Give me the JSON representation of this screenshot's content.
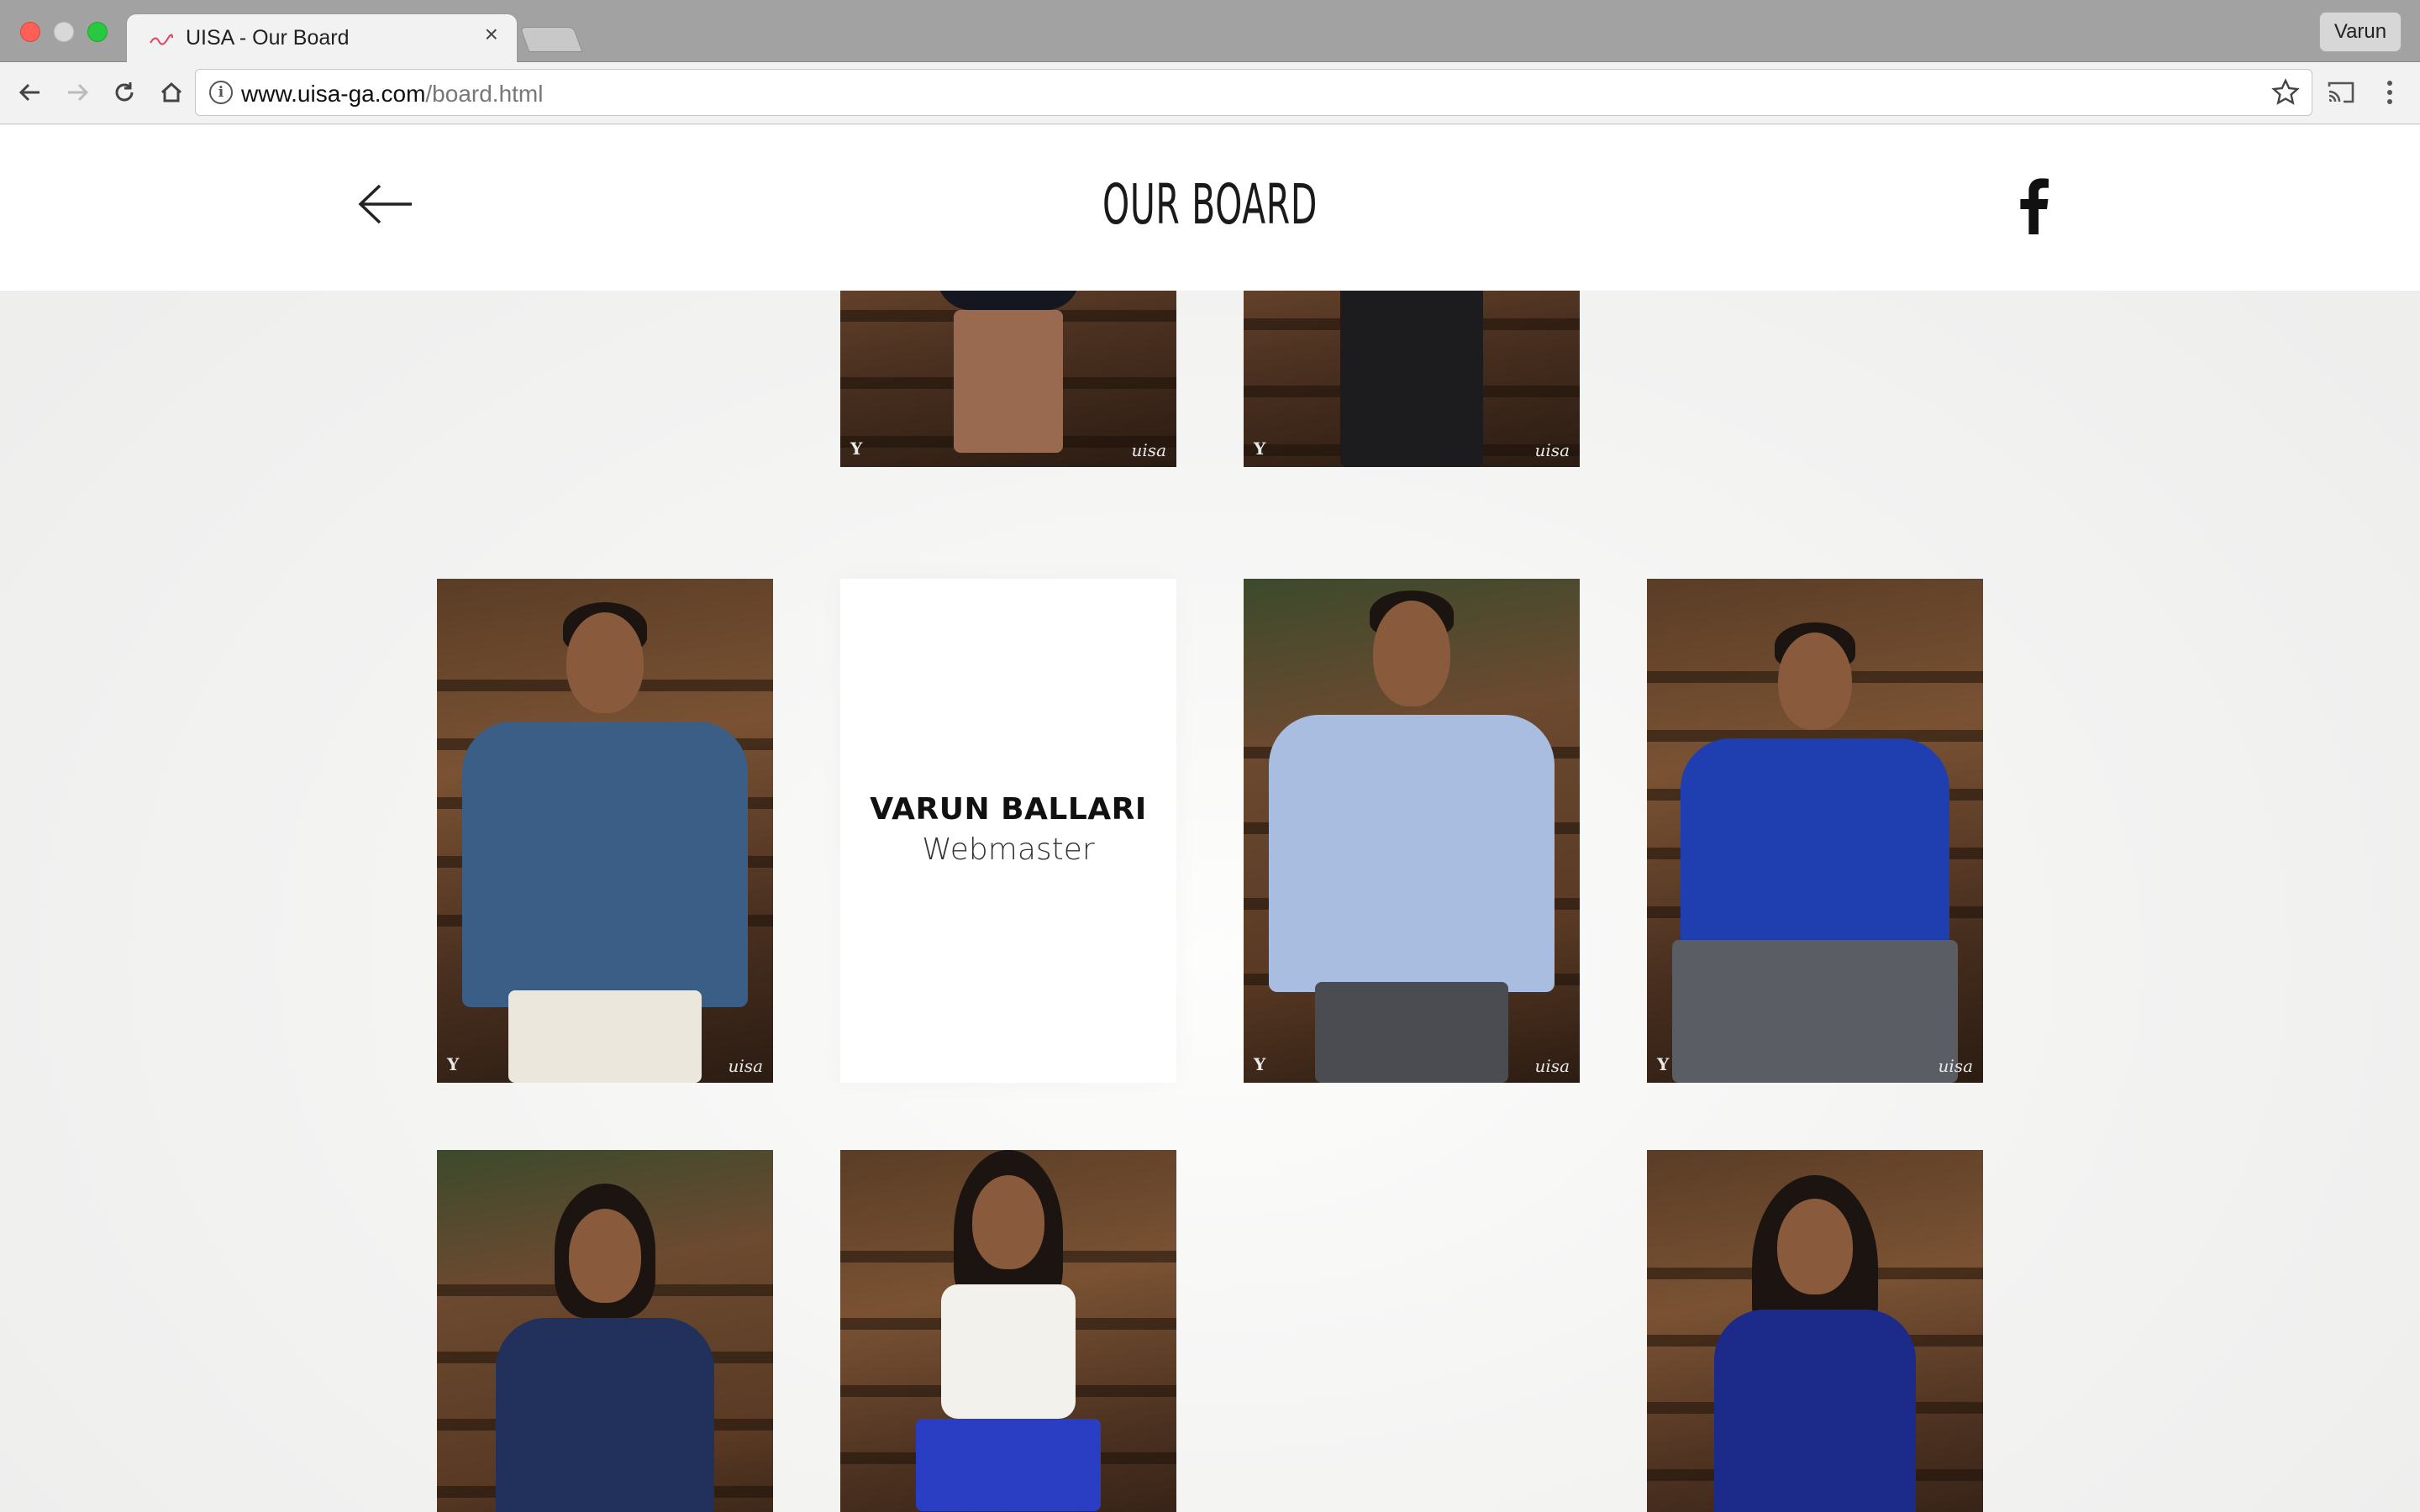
{
  "browser": {
    "tab_title": "UISA - Our Board",
    "tab_close": "×",
    "profile_name": "Varun",
    "url_host": "www.uisa-ga.com",
    "url_path": "/board.html"
  },
  "header": {
    "title": "OUR BOARD"
  },
  "board": {
    "featured": {
      "name": "VARUN BALLARI",
      "role": "Webmaster"
    },
    "watermark_left": "Y",
    "watermark_right": "uisa"
  }
}
